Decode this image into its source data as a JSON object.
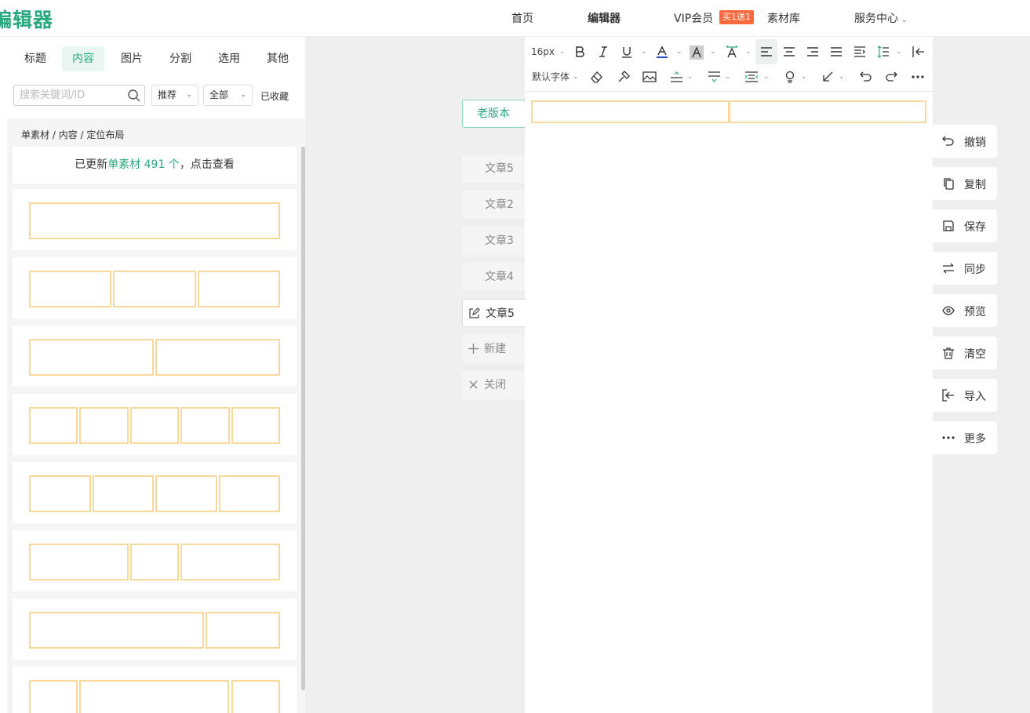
{
  "header": {
    "logo_text": "编辑器",
    "nav": {
      "home": "首页",
      "editor": "编辑器",
      "vip": "VIP会员",
      "vip_badge": "买1送1",
      "materials": "素材库",
      "service": "服务中心"
    }
  },
  "sidebar": {
    "tabs": [
      "标题",
      "内容",
      "图片",
      "分割",
      "选用",
      "其他"
    ],
    "active_tab": "内容",
    "search": {
      "placeholder": "搜索关键词/ID",
      "value": ""
    },
    "filter_recommend": "推荐",
    "filter_all": "全部",
    "favorites": "已收藏",
    "breadcrumb": [
      "单素材",
      "内容",
      "定位布局"
    ],
    "update_notice": {
      "prefix": "已更新",
      "highlight": "单素材 491 个",
      "suffix": "，点击查看"
    },
    "layout_templates": [
      "1 column",
      "3 equal columns",
      "2 equal columns",
      "5 equal columns",
      "4 equal columns",
      "3 columns wide-narrow-wide",
      "2 columns wide-narrow",
      "3 columns narrow-wide-narrow"
    ]
  },
  "middle": {
    "old_version": "老版本",
    "articles": [
      "文章5",
      "文章2",
      "文章3",
      "文章4",
      "文章5"
    ],
    "active_article": "文章5",
    "new_label": "新建",
    "close_label": "关闭"
  },
  "toolbar": {
    "font_size": "16px",
    "font_family": "默认字体"
  },
  "actions": [
    "撤销",
    "复制",
    "保存",
    "同步",
    "预览",
    "清空",
    "导入",
    "更多"
  ],
  "colors": {
    "brand": "#2aa87e",
    "badge": "#ff6a3d",
    "template_border": "#f8d99b"
  }
}
